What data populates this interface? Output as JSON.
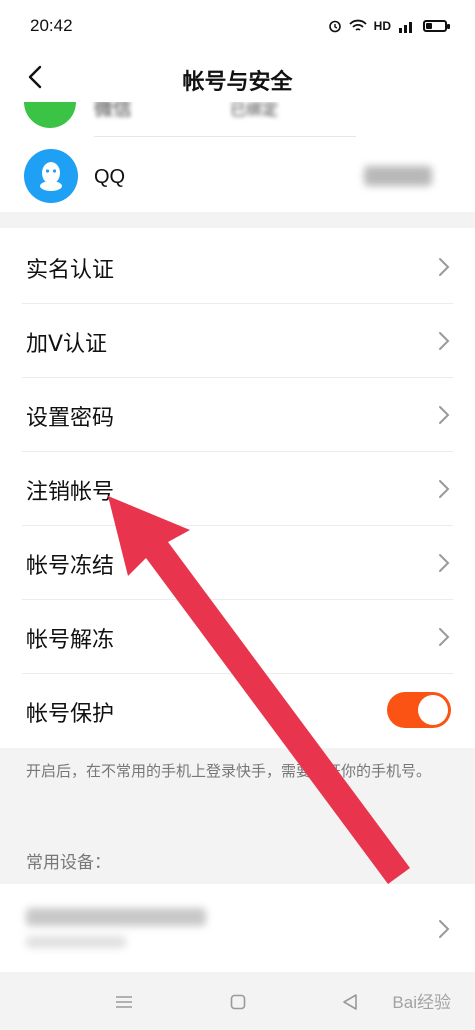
{
  "status_bar": {
    "time": "20:42",
    "network": "HD"
  },
  "header": {
    "title": "帐号与安全"
  },
  "linked_accounts": {
    "wechat": {
      "label": "微信",
      "value": "已绑定"
    },
    "qq": {
      "label": "QQ",
      "value": ""
    }
  },
  "menu": {
    "items": [
      {
        "label": "实名认证"
      },
      {
        "label": "加V认证"
      },
      {
        "label": "设置密码"
      },
      {
        "label": "注销帐号"
      },
      {
        "label": "帐号冻结"
      },
      {
        "label": "帐号解冻"
      }
    ],
    "protection": {
      "label": "帐号保护",
      "enabled": true
    }
  },
  "hint": "开启后，在不常用的手机上登录快手，需要验证你的手机号。",
  "devices": {
    "section_title": "常用设备："
  },
  "watermark": "Bai经验",
  "colors": {
    "accent": "#fa5314",
    "arrow": "#e8344c",
    "qq_blue": "#1ea0f4",
    "wechat_green": "#3ac345"
  }
}
